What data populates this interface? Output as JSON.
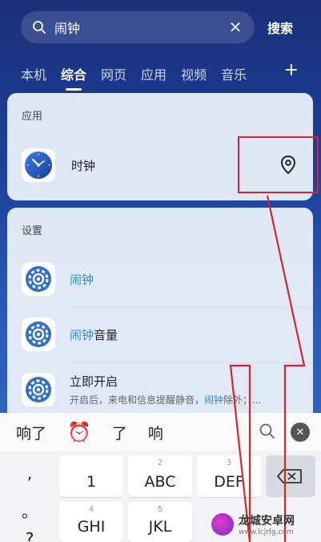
{
  "search": {
    "query": "闹钟",
    "clear_glyph": "✕",
    "button_label": "搜索"
  },
  "tabs": [
    {
      "label": "本机",
      "active": false
    },
    {
      "label": "综合",
      "active": true
    },
    {
      "label": "网页",
      "active": false
    },
    {
      "label": "应用",
      "active": false
    },
    {
      "label": "视频",
      "active": false
    },
    {
      "label": "音乐",
      "active": false
    }
  ],
  "tab_add": "+",
  "apps_section": {
    "title": "应用",
    "item": {
      "label": "时钟",
      "icon": "clock-app-icon",
      "action_icon": "location-pin-icon"
    }
  },
  "settings_section": {
    "title": "设置",
    "items": [
      {
        "title_highlight": "闹钟",
        "title_rest": "",
        "subtitle": ""
      },
      {
        "title_highlight": "闹钟",
        "title_rest": "音量",
        "subtitle": ""
      },
      {
        "title_highlight": "",
        "title_rest": "立即开启",
        "subtitle_pre": "开启后，来电和信息提醒静音，",
        "subtitle_hl": "闹钟",
        "subtitle_post": "除外；..."
      }
    ]
  },
  "keyboard": {
    "candidates": [
      "响了",
      "了",
      "响"
    ],
    "candidate_emoji": "⏰",
    "side_keys": [
      ",",
      "。",
      "?"
    ],
    "keys": [
      {
        "num": "",
        "main": "1"
      },
      {
        "num": "2",
        "main": "ABC"
      },
      {
        "num": "3",
        "main": "DEF"
      },
      {
        "num": "4",
        "main": "GHI"
      },
      {
        "num": "5",
        "main": "JKL"
      }
    ]
  },
  "watermark": {
    "title": "龙城安卓网",
    "url": "www.lcjrfg.com"
  },
  "colors": {
    "highlight": "#2a8fe0",
    "annotation": "#d9242a"
  }
}
